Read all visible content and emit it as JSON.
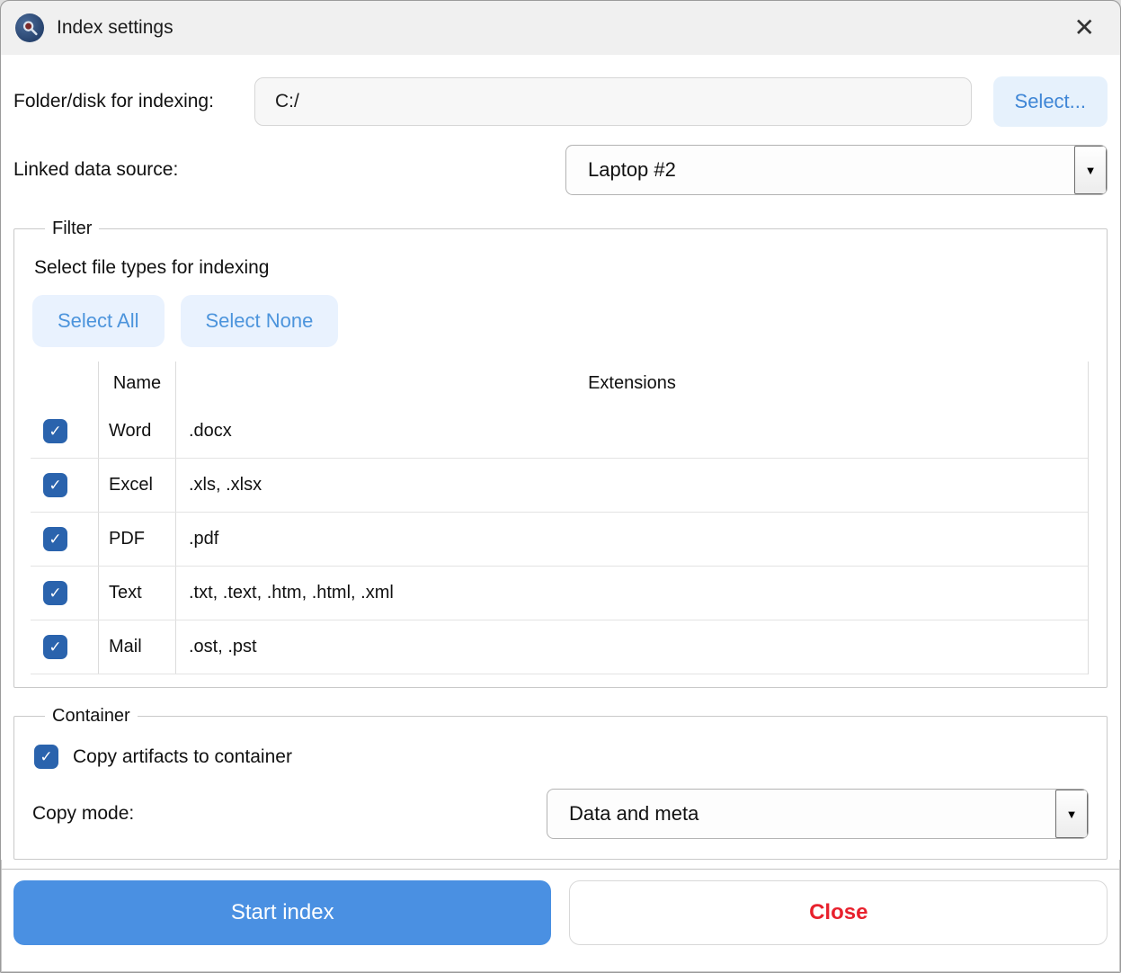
{
  "window": {
    "title": "Index settings",
    "close_glyph": "✕"
  },
  "glyphs": {
    "check": "✓",
    "dropdown_arrow": "▼"
  },
  "folder_row": {
    "label": "Folder/disk for indexing:",
    "value": "C:/",
    "select_button": "Select..."
  },
  "linked_source": {
    "label": "Linked data source:",
    "value": "Laptop #2"
  },
  "filter": {
    "legend": "Filter",
    "instruction": "Select file types for indexing",
    "select_all": "Select All",
    "select_none": "Select None",
    "table": {
      "name_header": "Name",
      "extensions_header": "Extensions",
      "rows": [
        {
          "name": "Word",
          "extensions": ".docx",
          "checked": true
        },
        {
          "name": "Excel",
          "extensions": ".xls, .xlsx",
          "checked": true
        },
        {
          "name": "PDF",
          "extensions": ".pdf",
          "checked": true
        },
        {
          "name": "Text",
          "extensions": ".txt, .text, .htm, .html, .xml",
          "checked": true
        },
        {
          "name": "Mail",
          "extensions": ".ost, .pst",
          "checked": true
        }
      ]
    }
  },
  "container": {
    "legend": "Container",
    "copy_artifacts_label": "Copy artifacts to container",
    "copy_artifacts_checked": true,
    "copy_mode_label": "Copy mode:",
    "copy_mode_value": "Data and meta"
  },
  "footer": {
    "start_button": "Start index",
    "close_button": "Close"
  },
  "colors": {
    "accent_blue": "#4a90e2",
    "checkbox_blue": "#2a63ad",
    "light_blue_button_bg": "#e9f2fe",
    "link_blue": "#4c94dc",
    "close_red": "#e8212d",
    "titlebar_bg": "#f0f0f0"
  }
}
